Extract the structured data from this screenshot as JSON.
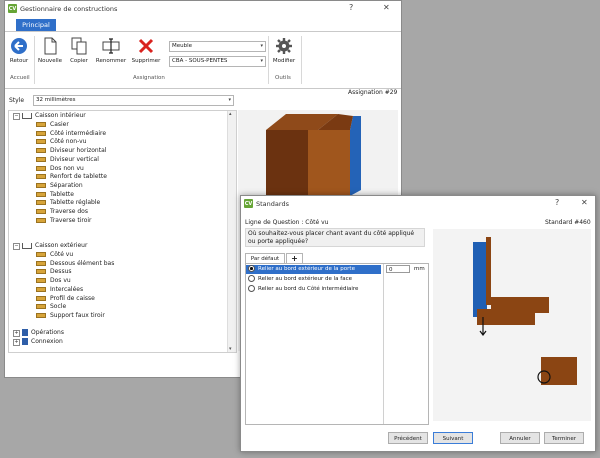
{
  "main": {
    "title": "Gestionnaire de constructions",
    "title_help": "?",
    "title_close": "✕",
    "ribbon_tab": "Principal",
    "buttons": {
      "retour": "Retour",
      "nouvelle": "Nouvelle",
      "copier": "Copier",
      "renommer": "Renommer",
      "supprimer": "Supprimer",
      "modifier": "Modifier"
    },
    "combo_category": "Meuble",
    "combo_construction": "CBA - SOUS-PENTES",
    "groups": {
      "accueil": "Accueil",
      "assignation": "Assignation",
      "outils": "Outils"
    },
    "style_label": "Style",
    "style_value": "32 millimètres",
    "assignation_label": "Assignation #29",
    "tree": {
      "caisson_interieur": "Caisson intérieur",
      "interieur_items": [
        "Casier",
        "Côté intermédiaire",
        "Côté non-vu",
        "Diviseur horizontal",
        "Diviseur vertical",
        "Dos non vu",
        "Renfort de tablette",
        "Séparation",
        "Tablette",
        "Tablette réglable",
        "Traverse dos",
        "Traverse tiroir"
      ],
      "caisson_exterieur": "Caisson extérieur",
      "exterieur_items": [
        "Côté vu",
        "Dessous élément bas",
        "Dessus",
        "Dos vu",
        "Intercalées",
        "Profil de caisse",
        "Socle",
        "Support faux tiroir"
      ],
      "operations": "Opérations",
      "connexion": "Connexion"
    }
  },
  "dialog": {
    "title": "Standards",
    "title_help": "?",
    "title_close": "✕",
    "question_label": "Ligne de Question : Côté vu",
    "standard_label": "Standard #460",
    "question_text": "Où souhaitez-vous placer chant avant du côté appliqué ou porte appliquée?",
    "tab_default": "Par défaut",
    "tab_add": "+",
    "options": [
      "Relier au bord extérieur de la porte",
      "Relier au bord extérieur de la face",
      "Relier au bord du Côté intermédiaire"
    ],
    "value_field": "0",
    "unit": "mm",
    "buttons": {
      "precedent": "Précédent",
      "suivant": "Suivant",
      "annuler": "Annuler",
      "terminer": "Terminer"
    }
  },
  "colors": {
    "accent": "#2f6fc9",
    "wood": "#8b4513",
    "panel_blue": "#1f5fb4",
    "logo_green": "#66a536"
  }
}
